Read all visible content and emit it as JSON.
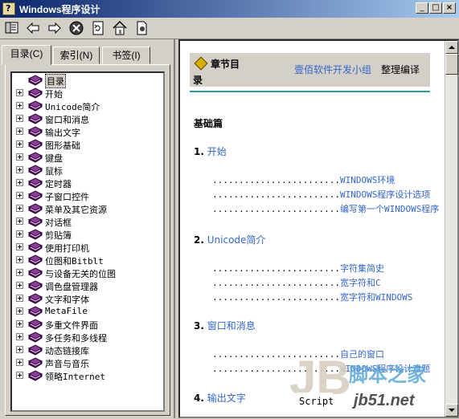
{
  "window": {
    "title": "Windows程序设计",
    "minimize_glyph": "_",
    "maximize_glyph": "□",
    "close_glyph": "×"
  },
  "toolbar": {
    "buttons": [
      "toggle-pane-icon",
      "back-arrow-icon",
      "forward-arrow-icon",
      "stop-icon",
      "refresh-icon",
      "home-icon",
      "print-icon"
    ]
  },
  "tabs": [
    {
      "label": "目录(C)",
      "active": true
    },
    {
      "label": "索引(N)",
      "active": false
    },
    {
      "label": "书签(I)",
      "active": false
    }
  ],
  "tree": {
    "items": [
      {
        "label": "目录",
        "expandable": false,
        "selected": true
      },
      {
        "label": "开始",
        "expandable": true
      },
      {
        "label": "Unicode简介",
        "expandable": true
      },
      {
        "label": "窗口和消息",
        "expandable": true
      },
      {
        "label": "输出文字",
        "expandable": true
      },
      {
        "label": "图形基础",
        "expandable": true
      },
      {
        "label": "键盘",
        "expandable": true
      },
      {
        "label": "鼠标",
        "expandable": true
      },
      {
        "label": "定时器",
        "expandable": true
      },
      {
        "label": "子窗口控件",
        "expandable": true
      },
      {
        "label": "菜单及其它资源",
        "expandable": true
      },
      {
        "label": "对话框",
        "expandable": true
      },
      {
        "label": "剪贴簿",
        "expandable": true
      },
      {
        "label": "使用打印机",
        "expandable": true
      },
      {
        "label": "位图和Bitblt",
        "expandable": true
      },
      {
        "label": "与设备无关的位图",
        "expandable": true
      },
      {
        "label": "调色盘管理器",
        "expandable": true
      },
      {
        "label": "文字和字体",
        "expandable": true
      },
      {
        "label": "MetaFile",
        "expandable": true
      },
      {
        "label": "多重文件界面",
        "expandable": true
      },
      {
        "label": "多任务和多线程",
        "expandable": true
      },
      {
        "label": "动态链接库",
        "expandable": true
      },
      {
        "label": "声音与音乐",
        "expandable": true
      },
      {
        "label": "领略Internet",
        "expandable": true
      }
    ]
  },
  "content": {
    "header_chapter_1": "章节目",
    "header_chapter_2": "录",
    "group_link": "壹佰软件开发小组",
    "edit_text": "整理编译",
    "section_title": "基础篇",
    "chapters": [
      {
        "num": "1.",
        "title": "开始",
        "subs": [
          "WINDOWS环境",
          "WINDOWS程序设计选项",
          "编写第一个WINDOWS程序"
        ]
      },
      {
        "num": "2.",
        "title": "Unicode简介",
        "subs": [
          "字符集简史",
          "宽字符和C",
          "宽字符和WINDOWS"
        ]
      },
      {
        "num": "3.",
        "title": "窗口和消息",
        "subs": [
          "自己的窗口",
          "WINDOWS程序设计难题"
        ]
      },
      {
        "num": "4.",
        "title": "输出文字",
        "subs": []
      }
    ],
    "dots": "........................"
  },
  "watermark": {
    "logo_text": "Script",
    "site_name": "脚本之家",
    "site_url": "jb51.net"
  },
  "colors": {
    "link": "#3366cc",
    "accent_rule": "#2aa198",
    "titlebar_start": "#0a246a",
    "titlebar_end": "#a6caf0"
  }
}
